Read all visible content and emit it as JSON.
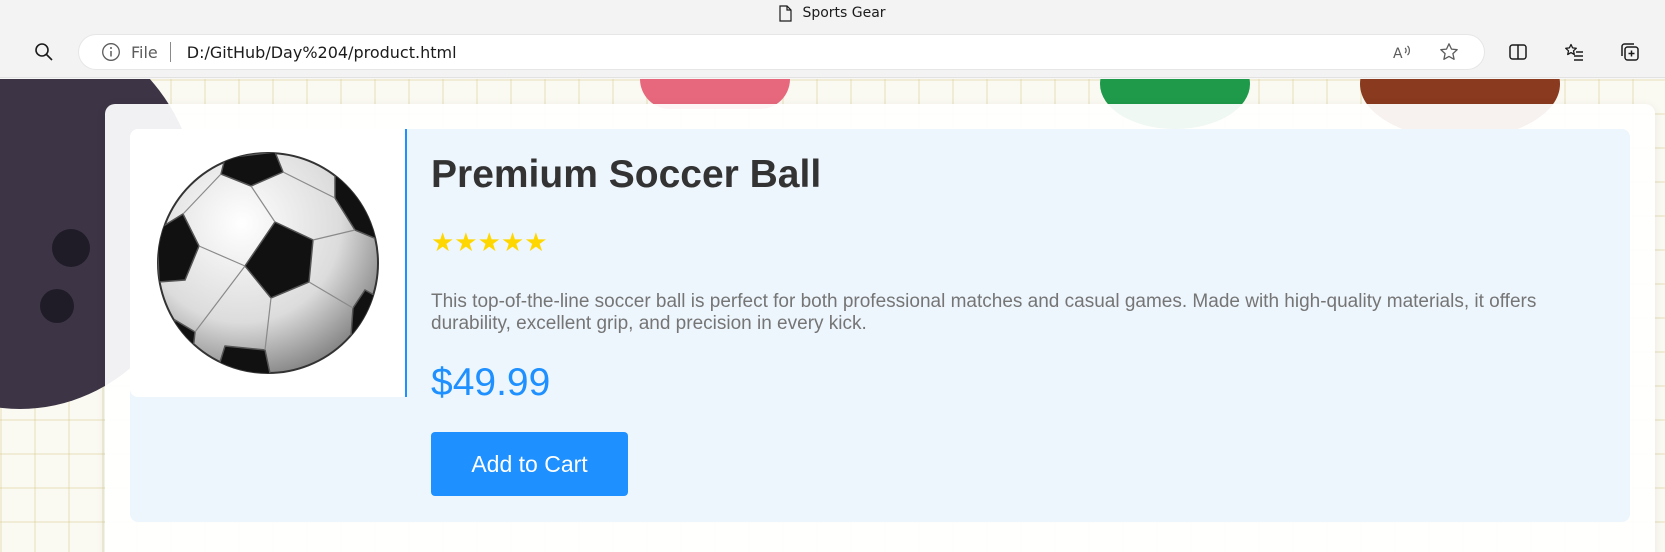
{
  "browser": {
    "tab_title": "Sports Gear",
    "address": {
      "security_label": "File",
      "url": "D:/GitHub/Day%204/product.html"
    },
    "icons": [
      "search-icon",
      "info-icon",
      "read-aloud-icon",
      "favorite-star-icon",
      "split-screen-icon",
      "favorites-icon",
      "collections-icon"
    ]
  },
  "product": {
    "image_alt": "Soccer ball",
    "title": "Premium Soccer Ball",
    "rating": {
      "stars": "★★★★★",
      "value": 5,
      "max": 5,
      "color": "#ffd700"
    },
    "description": "This top-of-the-line soccer ball is perfect for both professional matches and casual games. Made with high-quality materials, it offers durability, excellent grip, and precision in every kick.",
    "price": "$49.99",
    "add_to_cart_label": "Add to Cart"
  },
  "colors": {
    "accent": "#1e90ff",
    "title": "#333333",
    "description": "#757575",
    "card_background": "#eef6fd"
  }
}
